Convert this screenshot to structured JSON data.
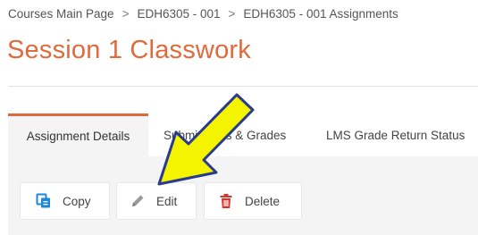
{
  "breadcrumb": {
    "items": [
      "Courses Main Page",
      "EDH6305 - 001",
      "EDH6305 - 001 Assignments"
    ],
    "separator": ">"
  },
  "page": {
    "title": "Session 1 Classwork"
  },
  "tabs": [
    {
      "label": "Assignment Details",
      "active": true
    },
    {
      "label": "Submissions & Grades",
      "active": false
    },
    {
      "label": "LMS Grade Return Status",
      "active": false
    }
  ],
  "actions": {
    "copy_label": "Copy",
    "edit_label": "Edit",
    "delete_label": "Delete"
  },
  "icons": {
    "copy": "copy-icon",
    "edit": "pencil-icon",
    "delete": "trash-icon",
    "annotation": "pointer-arrow-annotation"
  },
  "colors": {
    "accent": "#e06a3b",
    "copy_icon": "#1e88d8",
    "edit_icon": "#9a9a9a",
    "delete_icon": "#d9342b",
    "annotation_fill": "#f4f400",
    "annotation_stroke": "#2a3a8f",
    "panel_bg": "#f4f4f4"
  }
}
